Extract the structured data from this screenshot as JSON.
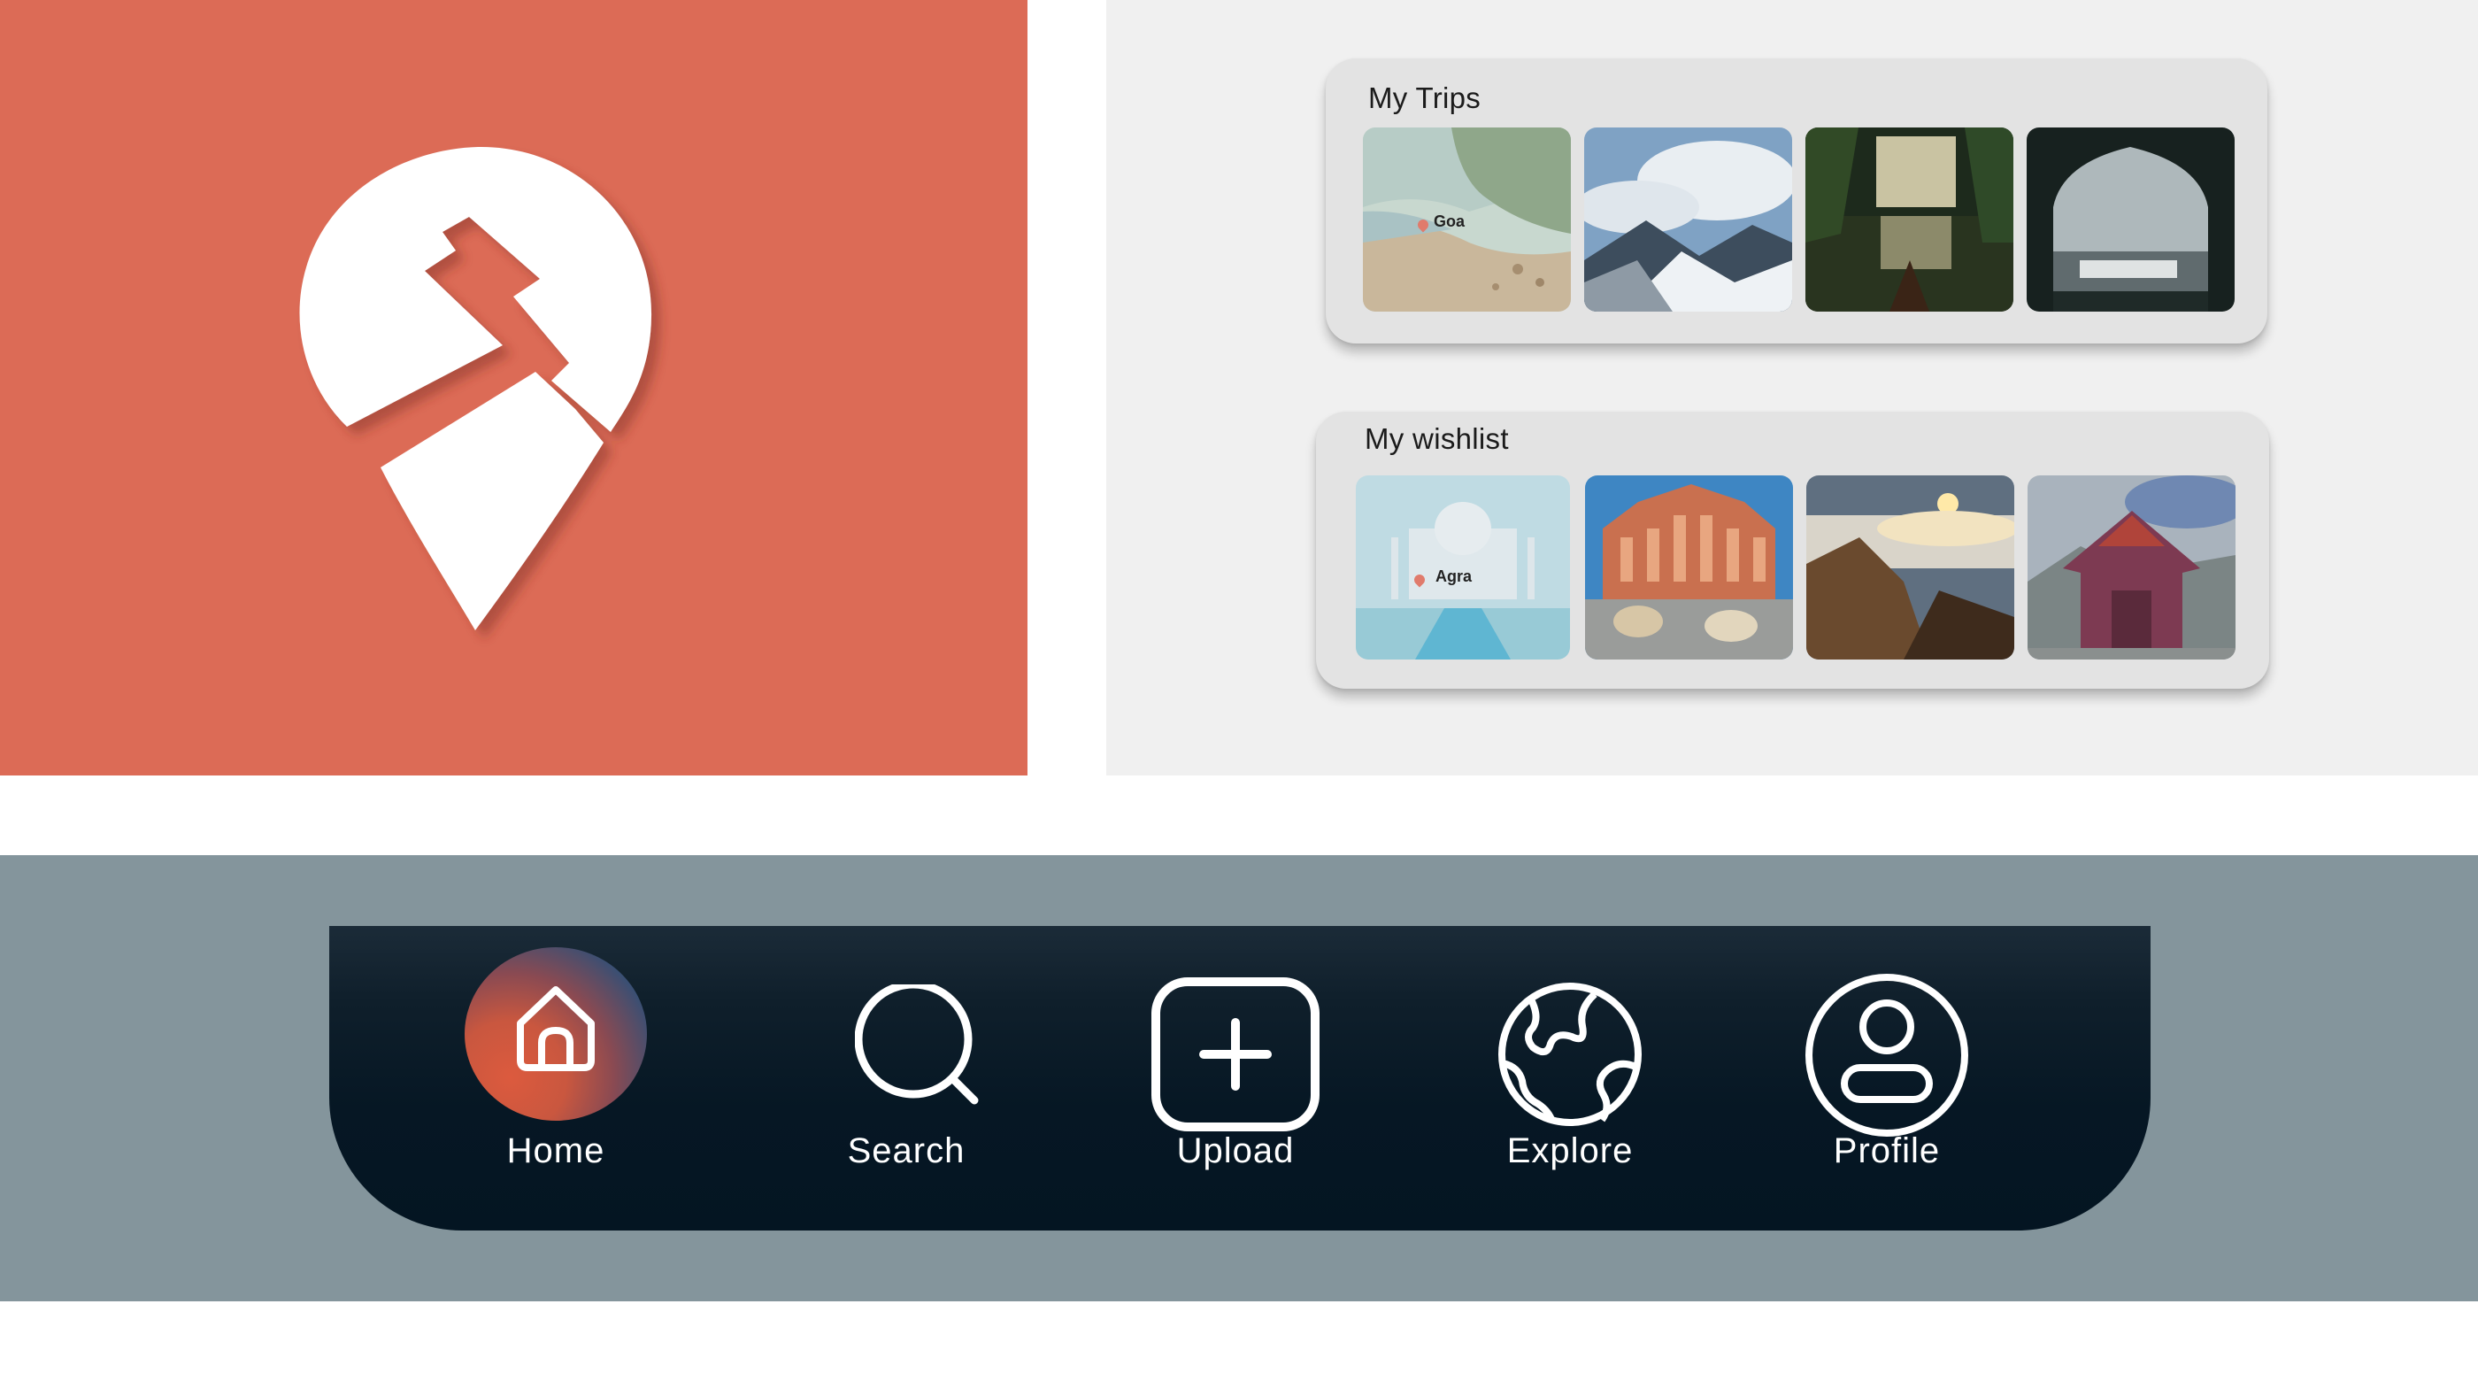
{
  "colors": {
    "brand_coral": "#dc6b56",
    "cards_background": "#f0f0f0",
    "card_surface": "#e3e3e3",
    "nav_background": "#84959c",
    "nav_bar": "#061724",
    "nav_text": "#ffffff"
  },
  "logo": {
    "icon": "map-pin-t-icon"
  },
  "my_trips": {
    "title": "My Trips",
    "photos": [
      {
        "icon": "beach-photo",
        "tag": "Goa"
      },
      {
        "icon": "snowy-mountains-photo"
      },
      {
        "icon": "backwaters-palm-photo"
      },
      {
        "icon": "lake-palace-arch-photo"
      }
    ]
  },
  "my_wishlist": {
    "title": "My wishlist",
    "photos": [
      {
        "icon": "taj-mahal-photo",
        "tag": "Agra"
      },
      {
        "icon": "hawa-mahal-photo"
      },
      {
        "icon": "sunrise-clouds-photo"
      },
      {
        "icon": "monastery-photo"
      }
    ]
  },
  "nav": {
    "items": [
      {
        "label": "Home",
        "icon": "home-icon",
        "active": true
      },
      {
        "label": "Search",
        "icon": "search-icon"
      },
      {
        "label": "Upload",
        "icon": "upload-plus-icon"
      },
      {
        "label": "Explore",
        "icon": "globe-icon"
      },
      {
        "label": "Profile",
        "icon": "profile-icon"
      }
    ]
  }
}
